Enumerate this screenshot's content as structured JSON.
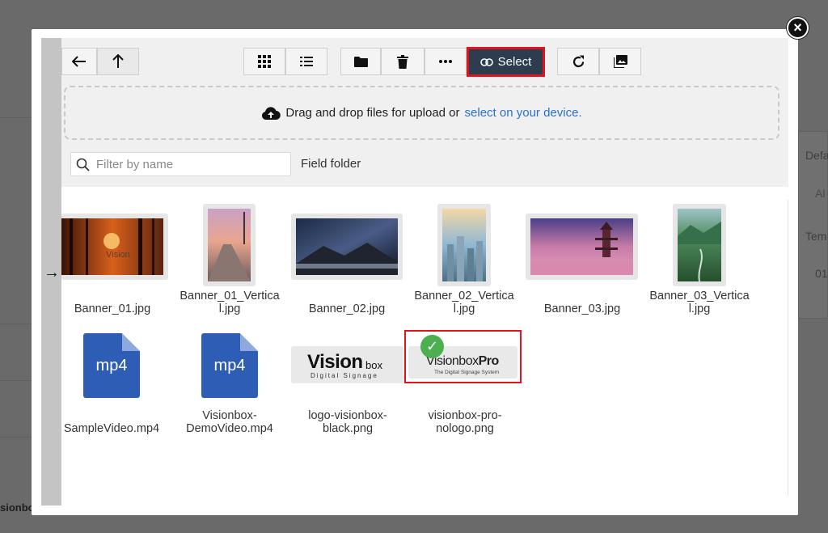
{
  "modal": {
    "close_label": "×",
    "toolbar": {
      "select_label": "Select"
    },
    "dropzone": {
      "text": "Drag and drop files for upload or",
      "link": "select on your device."
    },
    "filter": {
      "placeholder": "Filter by name",
      "value": ""
    },
    "field_folder_label": "Field folder",
    "files": [
      {
        "name": "Banner_01.jpg",
        "type": "image"
      },
      {
        "name": "Banner_01_Vertica\nl.jpg",
        "type": "image"
      },
      {
        "name": "Banner_02.jpg",
        "type": "image"
      },
      {
        "name": "Banner_02_Vertica\nl.jpg",
        "type": "image"
      },
      {
        "name": "Banner_03.jpg",
        "type": "image"
      },
      {
        "name": "Banner_03_Vertica\nl.jpg",
        "type": "image"
      },
      {
        "name": "SampleVideo.mp4",
        "type": "video",
        "ext": "mp4"
      },
      {
        "name": "Visionbox-\nDemoVideo.mp4",
        "type": "video",
        "ext": "mp4"
      },
      {
        "name": "logo-visionbox-\nblack.png",
        "type": "image"
      },
      {
        "name": "visionbox-pro-\nnologo.png",
        "type": "image",
        "selected": true
      }
    ],
    "logos": {
      "visionbox_main": "Vision",
      "visionbox_small": "box",
      "visionbox_sub": "Digital Signage",
      "pro_main": "Visionbox",
      "pro_bold": "Pro",
      "pro_sub": "The Digital Signage System"
    }
  },
  "background": {
    "right_labels": [
      "Defa",
      "Al",
      "Tem",
      "01"
    ],
    "bottom_label": "sionbo"
  },
  "colors": {
    "select_bg": "#2d3d4f",
    "highlight": "#e0141e",
    "link": "#2a6fd6",
    "check": "#4caf50",
    "doc": "#2e5db5"
  }
}
